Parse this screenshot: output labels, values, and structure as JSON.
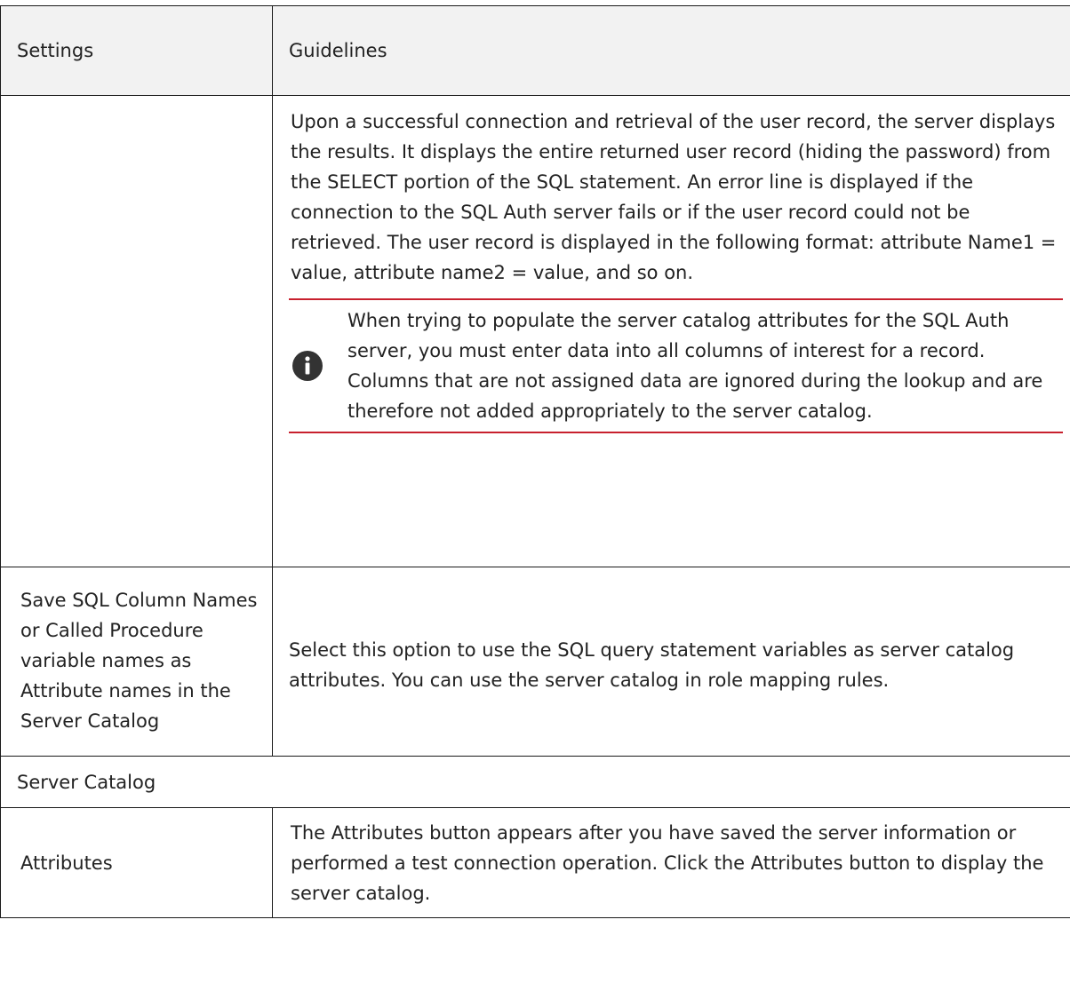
{
  "table": {
    "headers": {
      "settings": "Settings",
      "guidelines": "Guidelines"
    },
    "rows": {
      "result": {
        "setting": "",
        "guideline": "Upon a successful connection and retrieval of the user record, the server displays the results. It displays the entire returned user record (hiding the password) from the SELECT portion of the SQL statement. An error line is displayed if the connection to the SQL Auth server fails or if the user record could not be retrieved. The user record is displayed in the following format: attribute Name1 = value, attribute name2 = value, and so on.",
        "note": {
          "icon": "info-icon",
          "text": "When trying to populate the server catalog attributes for the SQL Auth server, you must enter data into all columns of interest for a record. Columns that are not assigned data are ignored during the lookup and are therefore not added appropriately to the server catalog."
        }
      },
      "save_columns": {
        "setting": "Save SQL Column Names or Called Procedure variable names as Attribute names in the Server Catalog",
        "guideline": "Select this option to use the SQL query statement variables as server catalog attributes. You can use the server catalog in role mapping rules."
      },
      "section": {
        "label": "Server Catalog"
      },
      "attributes": {
        "setting": "Attributes",
        "guideline": "The Attributes button appears after you have saved the server information or performed a test connection operation. Click the Attributes button to display the server catalog."
      }
    }
  },
  "colors": {
    "border": "#1a1a1a",
    "header_bg": "#f2f2f2",
    "note_rule": "#c8202e",
    "note_icon": "#333333"
  }
}
